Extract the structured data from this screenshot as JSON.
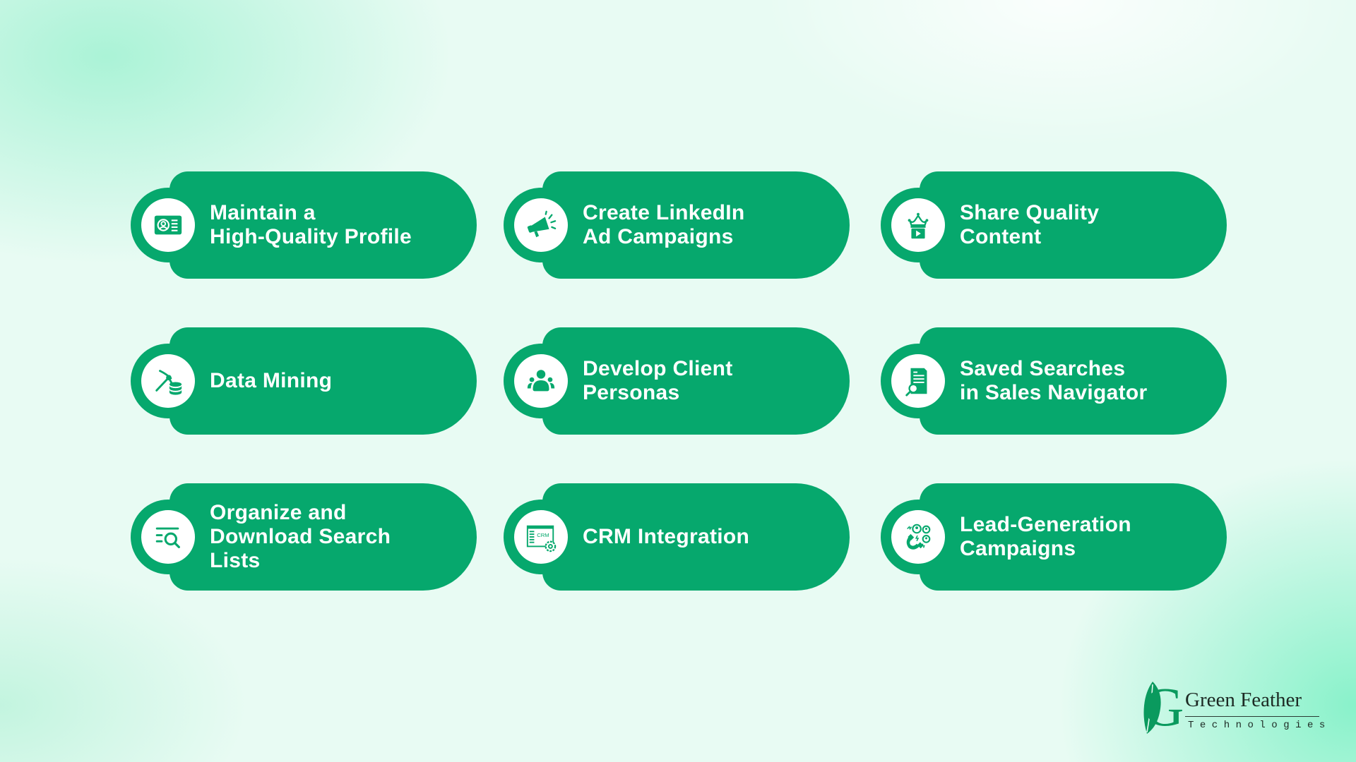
{
  "theme": {
    "card_color": "#06A86D",
    "icon_bg": "#FFFFFF",
    "text_color": "#FFFFFF"
  },
  "cards": [
    {
      "label": "Maintain a\nHigh-Quality Profile",
      "icon": "profile-card-icon"
    },
    {
      "label": "Create LinkedIn\nAd Campaigns",
      "icon": "megaphone-icon"
    },
    {
      "label": "Share Quality\nContent",
      "icon": "crown-video-icon"
    },
    {
      "label": "Data Mining",
      "icon": "pickaxe-database-icon"
    },
    {
      "label": "Develop Client\nPersonas",
      "icon": "user-group-icon"
    },
    {
      "label": "Saved Searches\nin Sales Navigator",
      "icon": "document-search-icon"
    },
    {
      "label": "Organize and\nDownload Search\nLists",
      "icon": "list-search-icon"
    },
    {
      "label": "CRM Integration",
      "icon": "crm-settings-icon"
    },
    {
      "label": "Lead-Generation\nCampaigns",
      "icon": "magnet-leads-icon"
    }
  ],
  "icon_texts": {
    "crm": "CRM"
  },
  "logo": {
    "initial": "G",
    "name": "Green Feather",
    "tagline": "Technologies"
  }
}
